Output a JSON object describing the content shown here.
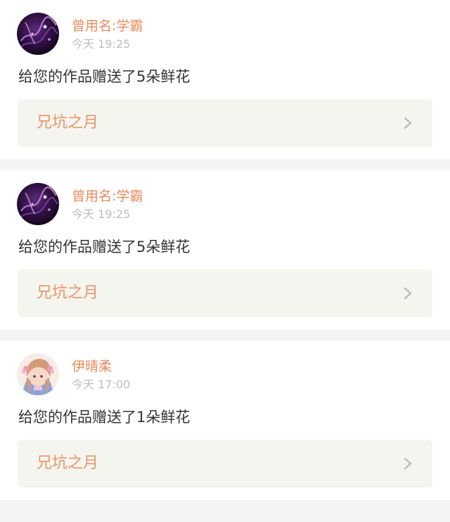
{
  "notifications": [
    {
      "avatar": "dark-purple-art-avatar",
      "username": "曾用名:学霸",
      "time": "今天 19:25",
      "message": "给您的作品赠送了5朵鲜花",
      "work_title": "兄坑之月",
      "chevron_icon": "chevron-right-icon"
    },
    {
      "avatar": "dark-purple-art-avatar",
      "username": "曾用名:学霸",
      "time": "今天 19:25",
      "message": "给您的作品赠送了5朵鲜花",
      "work_title": "兄坑之月",
      "chevron_icon": "chevron-right-icon"
    },
    {
      "avatar": "anime-girl-avatar",
      "username": "伊晴柔",
      "time": "今天 17:00",
      "message": "给您的作品赠送了1朵鲜花",
      "work_title": "兄坑之月",
      "chevron_icon": "chevron-right-icon"
    }
  ],
  "colors": {
    "accent": "#e88a5a",
    "timestamp": "#bdbdbd",
    "text": "#333333",
    "link_bg": "#f5f5ef",
    "page_bg": "#f4f4f4"
  }
}
